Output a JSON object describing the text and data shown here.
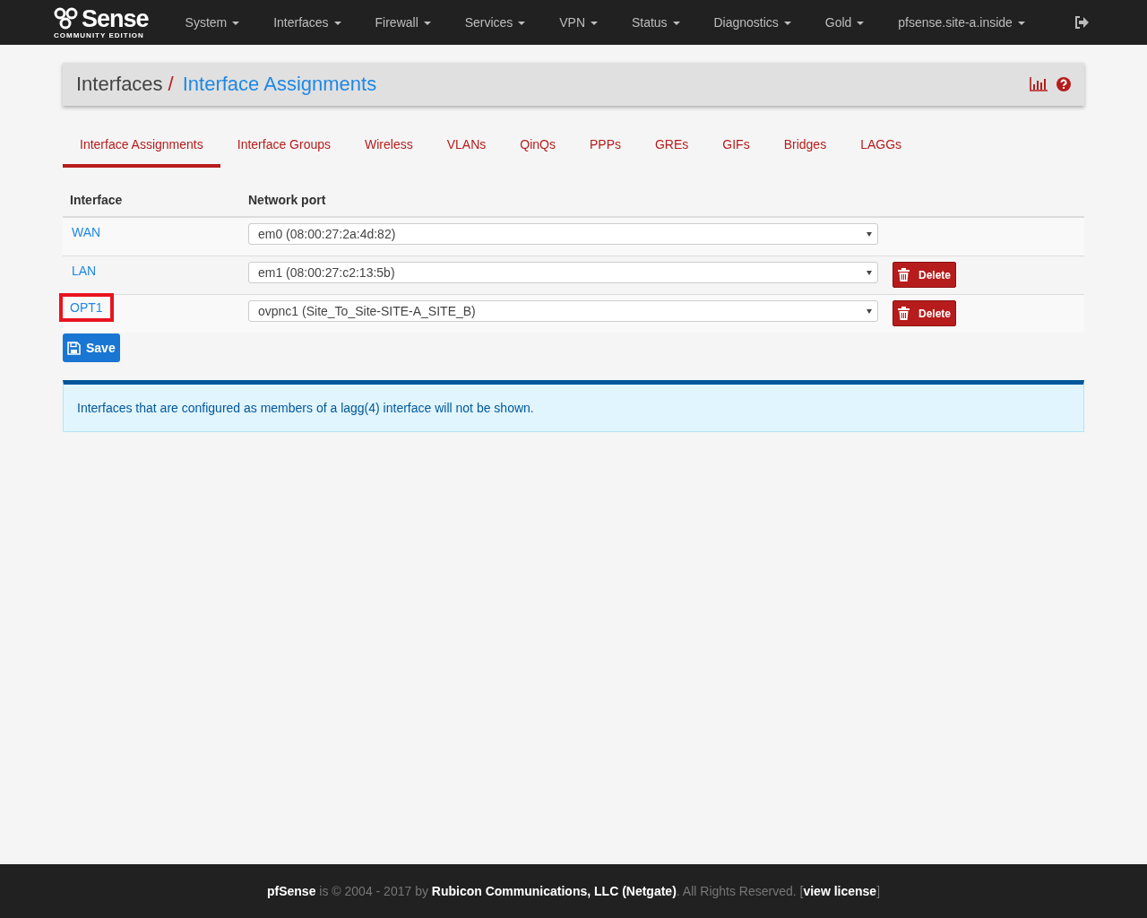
{
  "navbar": {
    "logo": {
      "word": "Sense",
      "subtitle": "COMMUNITY EDITION"
    },
    "menus": [
      "System",
      "Interfaces",
      "Firewall",
      "Services",
      "VPN",
      "Status",
      "Diagnostics",
      "Gold",
      "pfsense.site-a.inside"
    ]
  },
  "breadcrumb": {
    "parent": "Interfaces",
    "separator": "/",
    "current": "Interface Assignments"
  },
  "tabs": [
    {
      "label": "Interface Assignments",
      "selected": true
    },
    {
      "label": "Interface Groups",
      "selected": false
    },
    {
      "label": "Wireless",
      "selected": false
    },
    {
      "label": "VLANs",
      "selected": false
    },
    {
      "label": "QinQs",
      "selected": false
    },
    {
      "label": "PPPs",
      "selected": false
    },
    {
      "label": "GREs",
      "selected": false
    },
    {
      "label": "GIFs",
      "selected": false
    },
    {
      "label": "Bridges",
      "selected": false
    },
    {
      "label": "LAGGs",
      "selected": false
    }
  ],
  "table": {
    "columns": [
      "Interface",
      "Network port"
    ],
    "rows": [
      {
        "interface": "WAN",
        "port": "em0 (08:00:27:2a:4d:82)",
        "delete": null,
        "highlighted": false
      },
      {
        "interface": "LAN",
        "port": "em1 (08:00:27:c2:13:5b)",
        "delete": "Delete",
        "highlighted": false
      },
      {
        "interface": "OPT1",
        "port": "ovpnc1 (Site_To_Site-SITE-A_SITE_B)",
        "delete": "Delete",
        "highlighted": true
      }
    ]
  },
  "save_button": "Save",
  "info": "Interfaces that are configured as members of a lagg(4) interface will not be shown.",
  "footer": {
    "text": "**pfSense** is © 2004 - 2017 by **Rubicon Communications, LLC (Netgate)**. All Rights Reserved. [",
    "link": "view license",
    "after": "]"
  }
}
